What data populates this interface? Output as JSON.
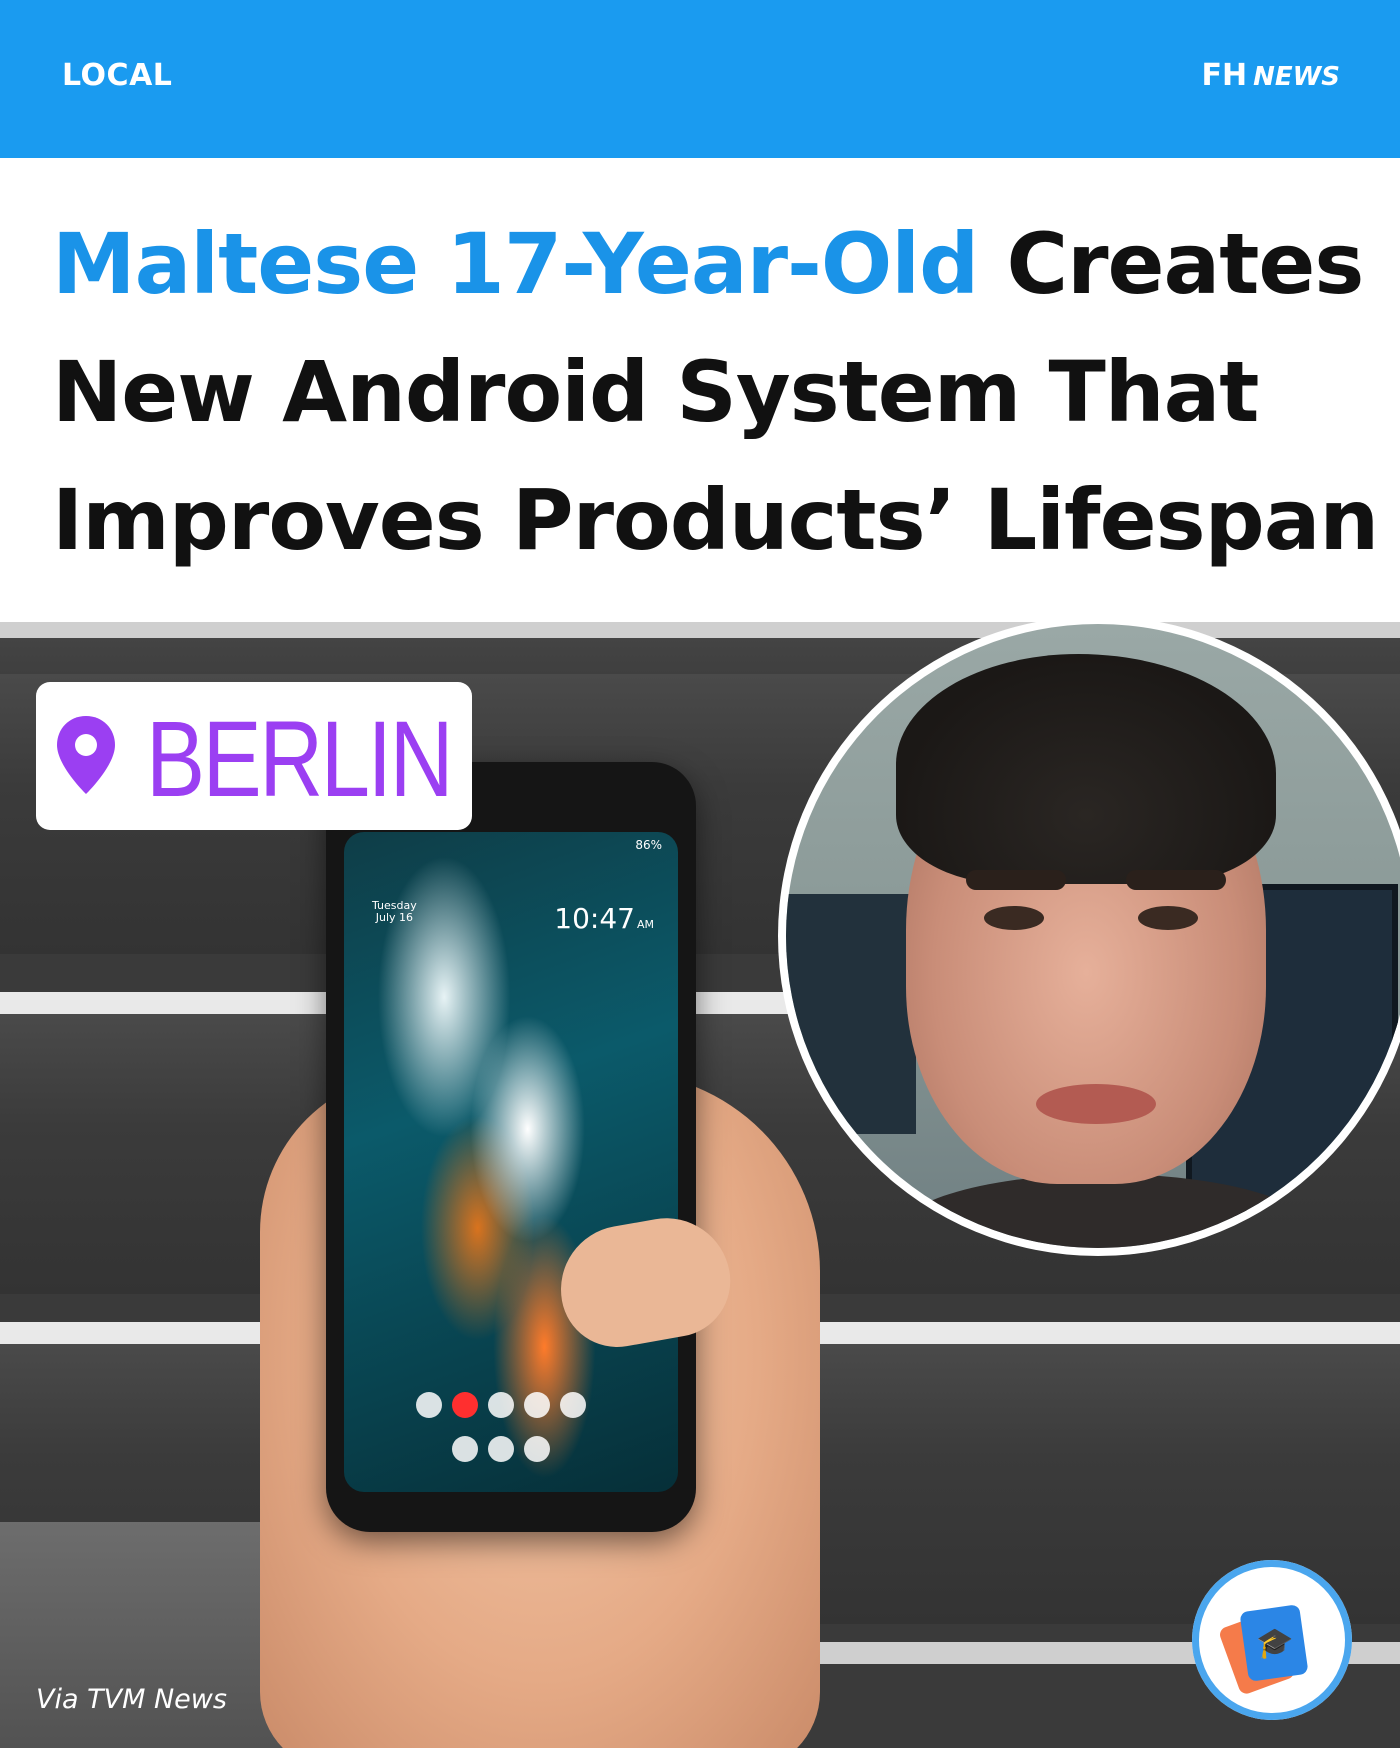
{
  "header": {
    "section": "LOCAL",
    "brand_main": "FH",
    "brand_sub": "NEWS"
  },
  "headline": {
    "highlight": "Maltese 17-Year-Old",
    "line1_rest": " Creates",
    "line2": "New Android System That",
    "line3": "Improves Products’ Lifespan"
  },
  "photo": {
    "location": "BERLIN",
    "credit": "Via TVM News",
    "phone_time": "10:47",
    "phone_time_suffix": "AM",
    "phone_status": "86%",
    "phone_day": "Tuesday",
    "phone_date": "July 16"
  },
  "icons": {
    "location_pin": "location-pin-icon",
    "app_badge": "graduation-app-icon"
  },
  "colors": {
    "topbar": "#1a9bf0",
    "highlight": "#1a93e8",
    "location_text": "#9b3ff2"
  }
}
